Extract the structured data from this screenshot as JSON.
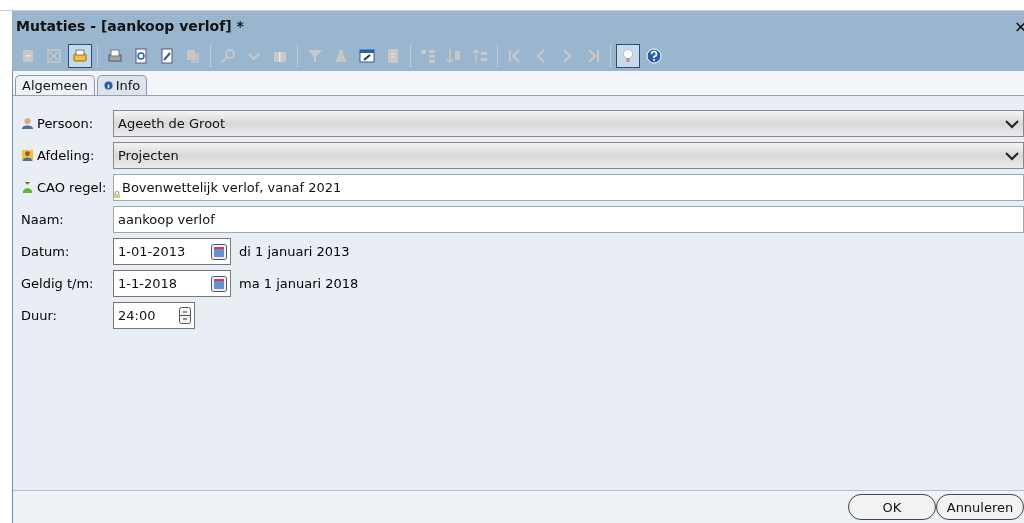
{
  "window": {
    "title": "Mutaties - [aankoop verlof] *",
    "close": "×"
  },
  "toolbar_groups": [
    {
      "items": [
        {
          "kind": "new",
          "disabled": true,
          "pressed": false
        },
        {
          "kind": "delete",
          "disabled": true,
          "pressed": false
        },
        {
          "kind": "print",
          "disabled": false,
          "pressed": true
        }
      ]
    },
    {
      "items": [
        {
          "kind": "printer",
          "disabled": false,
          "pressed": false
        },
        {
          "kind": "preview",
          "disabled": false,
          "pressed": false
        },
        {
          "kind": "edit",
          "disabled": false,
          "pressed": false
        },
        {
          "kind": "copy",
          "disabled": true,
          "pressed": false
        }
      ]
    },
    {
      "items": [
        {
          "kind": "search",
          "disabled": true,
          "pressed": false
        },
        {
          "kind": "check",
          "disabled": true,
          "pressed": false
        },
        {
          "kind": "columns",
          "disabled": true,
          "pressed": false
        }
      ]
    },
    {
      "items": [
        {
          "kind": "filter",
          "disabled": true,
          "pressed": false
        },
        {
          "kind": "flask",
          "disabled": true,
          "pressed": false
        },
        {
          "kind": "settings",
          "disabled": false,
          "pressed": false
        },
        {
          "kind": "doc",
          "disabled": true,
          "pressed": false
        }
      ]
    },
    {
      "items": [
        {
          "kind": "tree",
          "disabled": true,
          "pressed": false
        },
        {
          "kind": "sortdown",
          "disabled": true,
          "pressed": false
        },
        {
          "kind": "sortup",
          "disabled": true,
          "pressed": false
        }
      ]
    },
    {
      "items": [
        {
          "kind": "first",
          "disabled": true,
          "pressed": false
        },
        {
          "kind": "prev",
          "disabled": true,
          "pressed": false
        },
        {
          "kind": "next",
          "disabled": true,
          "pressed": false
        },
        {
          "kind": "last",
          "disabled": true,
          "pressed": false
        }
      ]
    },
    {
      "items": [
        {
          "kind": "bulb",
          "disabled": false,
          "pressed": true
        },
        {
          "kind": "help",
          "disabled": false,
          "pressed": false
        }
      ]
    }
  ],
  "tabs": [
    {
      "kind": "plain",
      "label": "Algemeen",
      "selected": true
    },
    {
      "kind": "info",
      "label": "Info",
      "selected": false
    }
  ],
  "fields": [
    {
      "kind": "dropdown",
      "label": "Persoon:",
      "value": "Ageeth de Groot"
    },
    {
      "kind": "dropdown",
      "label": "Afdeling:",
      "value": "Projecten"
    },
    {
      "kind": "locked",
      "label": "CAO regel:",
      "value": "Bovenwettelijk verlof, vanaf 2021"
    },
    {
      "kind": "text",
      "label": "Naam:",
      "value": "aankoop verlof"
    },
    {
      "kind": "date",
      "label": "Datum:",
      "value": "1-01-2013",
      "note": "di 1 januari 2013"
    },
    {
      "kind": "date",
      "label": "Geldig t/m:",
      "value": "1-1-2018",
      "note": "ma 1 januari 2018"
    },
    {
      "kind": "spin",
      "label": "Duur:",
      "value": "24:00"
    }
  ],
  "buttons": [
    "OK",
    "Annuleren"
  ]
}
